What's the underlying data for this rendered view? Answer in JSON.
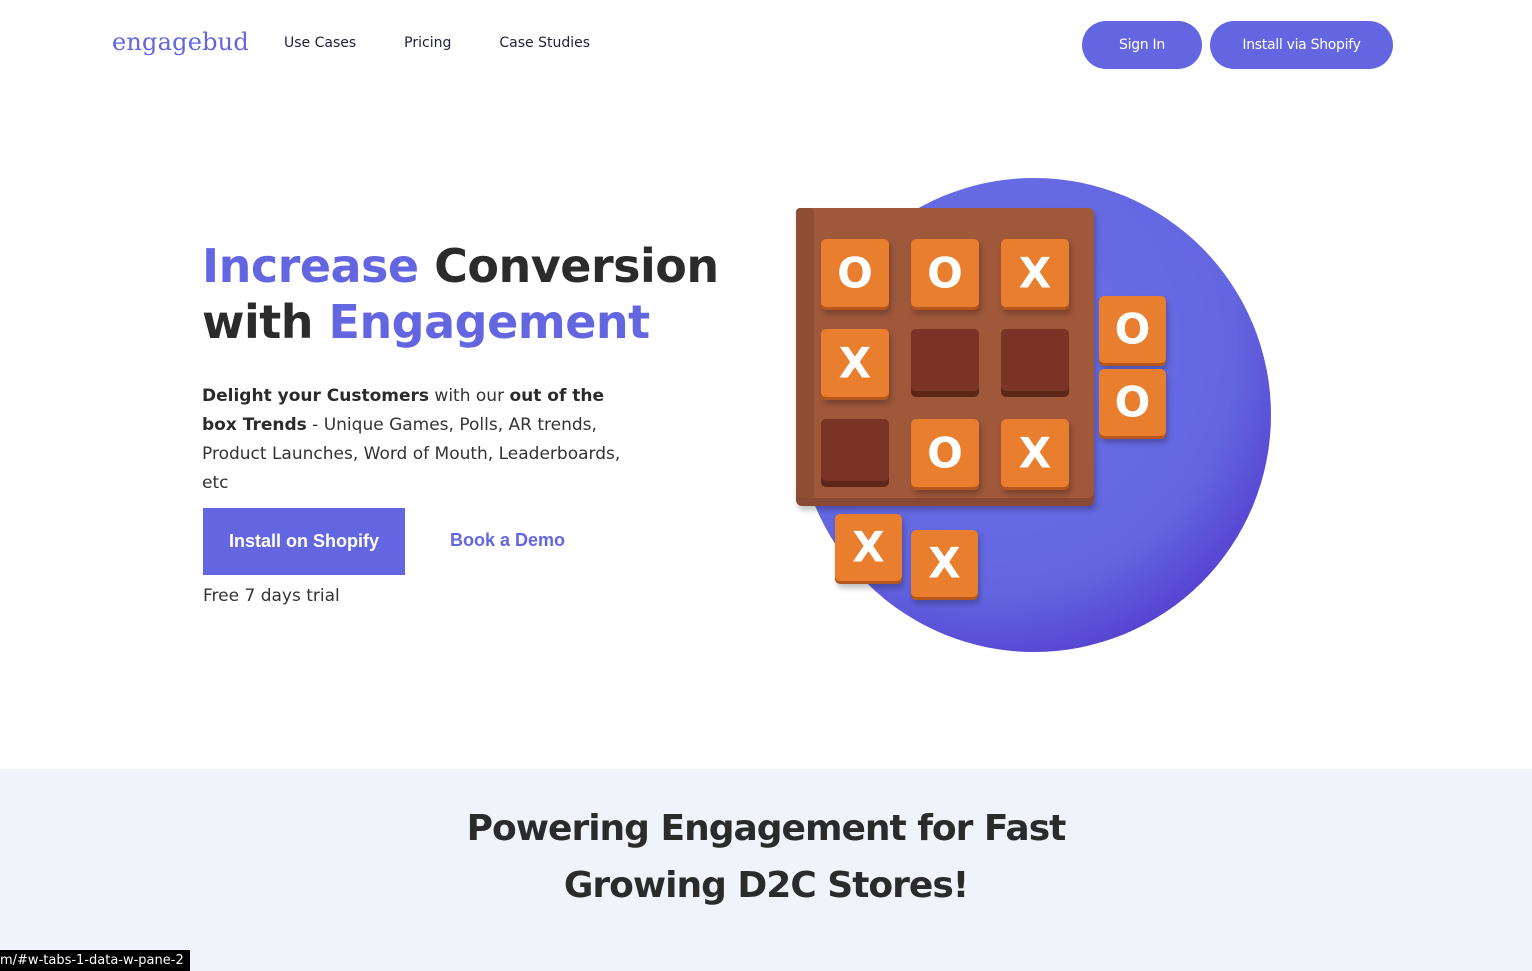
{
  "header": {
    "logo": "engagebud",
    "nav": [
      "Use Cases",
      "Pricing",
      "Case Studies"
    ],
    "sign_in": "Sign In",
    "install": "Install via Shopify"
  },
  "hero": {
    "title": {
      "word1": "Increase",
      "word2": " Conversion",
      "word3": "with ",
      "word4": "Engagement"
    },
    "description": {
      "bold1": "Delight your Customers",
      "text1": " with our ",
      "bold2": "out of the box Trends",
      "text2": " - Unique Games, Polls, AR trends, Product Launches, Word of Mouth, Leaderboards, etc"
    },
    "primary_cta": "Install on Shopify",
    "secondary_cta": "Book a Demo",
    "trial_note": "Free 7 days trial"
  },
  "illustration": {
    "board": [
      [
        "O",
        "O",
        "X"
      ],
      [
        "X",
        "",
        ""
      ],
      [
        "",
        "O",
        "X"
      ]
    ],
    "side_tiles": [
      "O",
      "O"
    ],
    "bottom_tiles": [
      "X",
      "X"
    ],
    "colors": {
      "circle": "#6366e0",
      "board": "#a0583a",
      "tile": "#e87e2e",
      "empty_cell": "#7a3425"
    }
  },
  "powering": {
    "line1": "Powering Engagement for Fast",
    "line2": "Growing D2C Stores!"
  },
  "status_bar": {
    "url": "m/#w-tabs-1-data-w-pane-2"
  }
}
